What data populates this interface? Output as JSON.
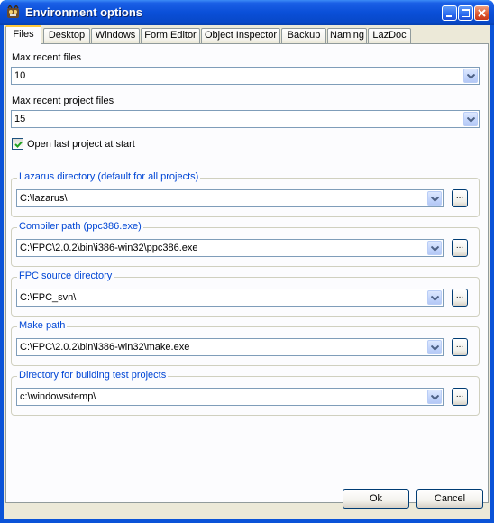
{
  "window": {
    "title": "Environment options",
    "icon": "lazarus-app-icon"
  },
  "title_buttons": [
    "minimize-icon",
    "maximize-icon",
    "close-icon"
  ],
  "tabs": [
    {
      "label": "Files",
      "active": true
    },
    {
      "label": "Desktop"
    },
    {
      "label": "Windows"
    },
    {
      "label": "Form Editor"
    },
    {
      "label": "Object Inspector"
    },
    {
      "label": "Backup"
    },
    {
      "label": "Naming"
    },
    {
      "label": "LazDoc"
    }
  ],
  "files_page": {
    "max_recent_files": {
      "label": "Max recent files",
      "value": "10"
    },
    "max_recent_project_files": {
      "label": "Max recent project files",
      "value": "15"
    },
    "open_last_project": {
      "label": "Open last project at start",
      "checked": true
    },
    "groups": [
      {
        "title": "Lazarus directory (default for all projects)",
        "value": "C:\\lazarus\\"
      },
      {
        "title": "Compiler path (ppc386.exe)",
        "value": "C:\\FPC\\2.0.2\\bin\\i386-win32\\ppc386.exe"
      },
      {
        "title": "FPC source directory",
        "value": "C:\\FPC_svn\\"
      },
      {
        "title": "Make path",
        "value": "C:\\FPC\\2.0.2\\bin\\i386-win32\\make.exe"
      },
      {
        "title": "Directory for building test projects",
        "value": "c:\\windows\\temp\\"
      }
    ],
    "browse_label": "..."
  },
  "buttons": {
    "ok": "Ok",
    "cancel": "Cancel"
  },
  "colors": {
    "title_bar": "#0a4fd8",
    "dialog_bg": "#ece9d8",
    "group_title": "#0046d5",
    "active_tab_accent": "#ffc83c"
  }
}
